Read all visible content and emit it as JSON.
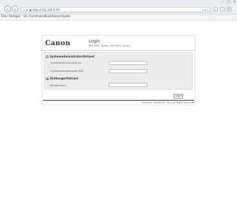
{
  "browser": {
    "address": "ⓘ ✕ ◉ http://192.168.0.97/",
    "search_control": "⌕ ▾ »"
  },
  "menu": {
    "items": [
      "Filer",
      "Redigér",
      "Vis",
      "Foretrukne",
      "Funktioner",
      "Hjælp"
    ]
  },
  "page": {
    "logo": "Canon",
    "login_title": "Login",
    "login_subtitle": "MF5900C Series / MF5900C Series /",
    "option_admin": "Systemadministratortilstand",
    "label_admin_id": "Systemadministrator-id:",
    "label_admin_pin": "Systemadministrator-PIN:",
    "option_general": "Slutbrugertilstand",
    "label_username": "Brugernavn:",
    "admin_id_value": "",
    "admin_pin_value": "",
    "username_value": "",
    "login_button": "Login",
    "copyright": "Copyright CANON INC. 2011 All Rights Reserved"
  }
}
